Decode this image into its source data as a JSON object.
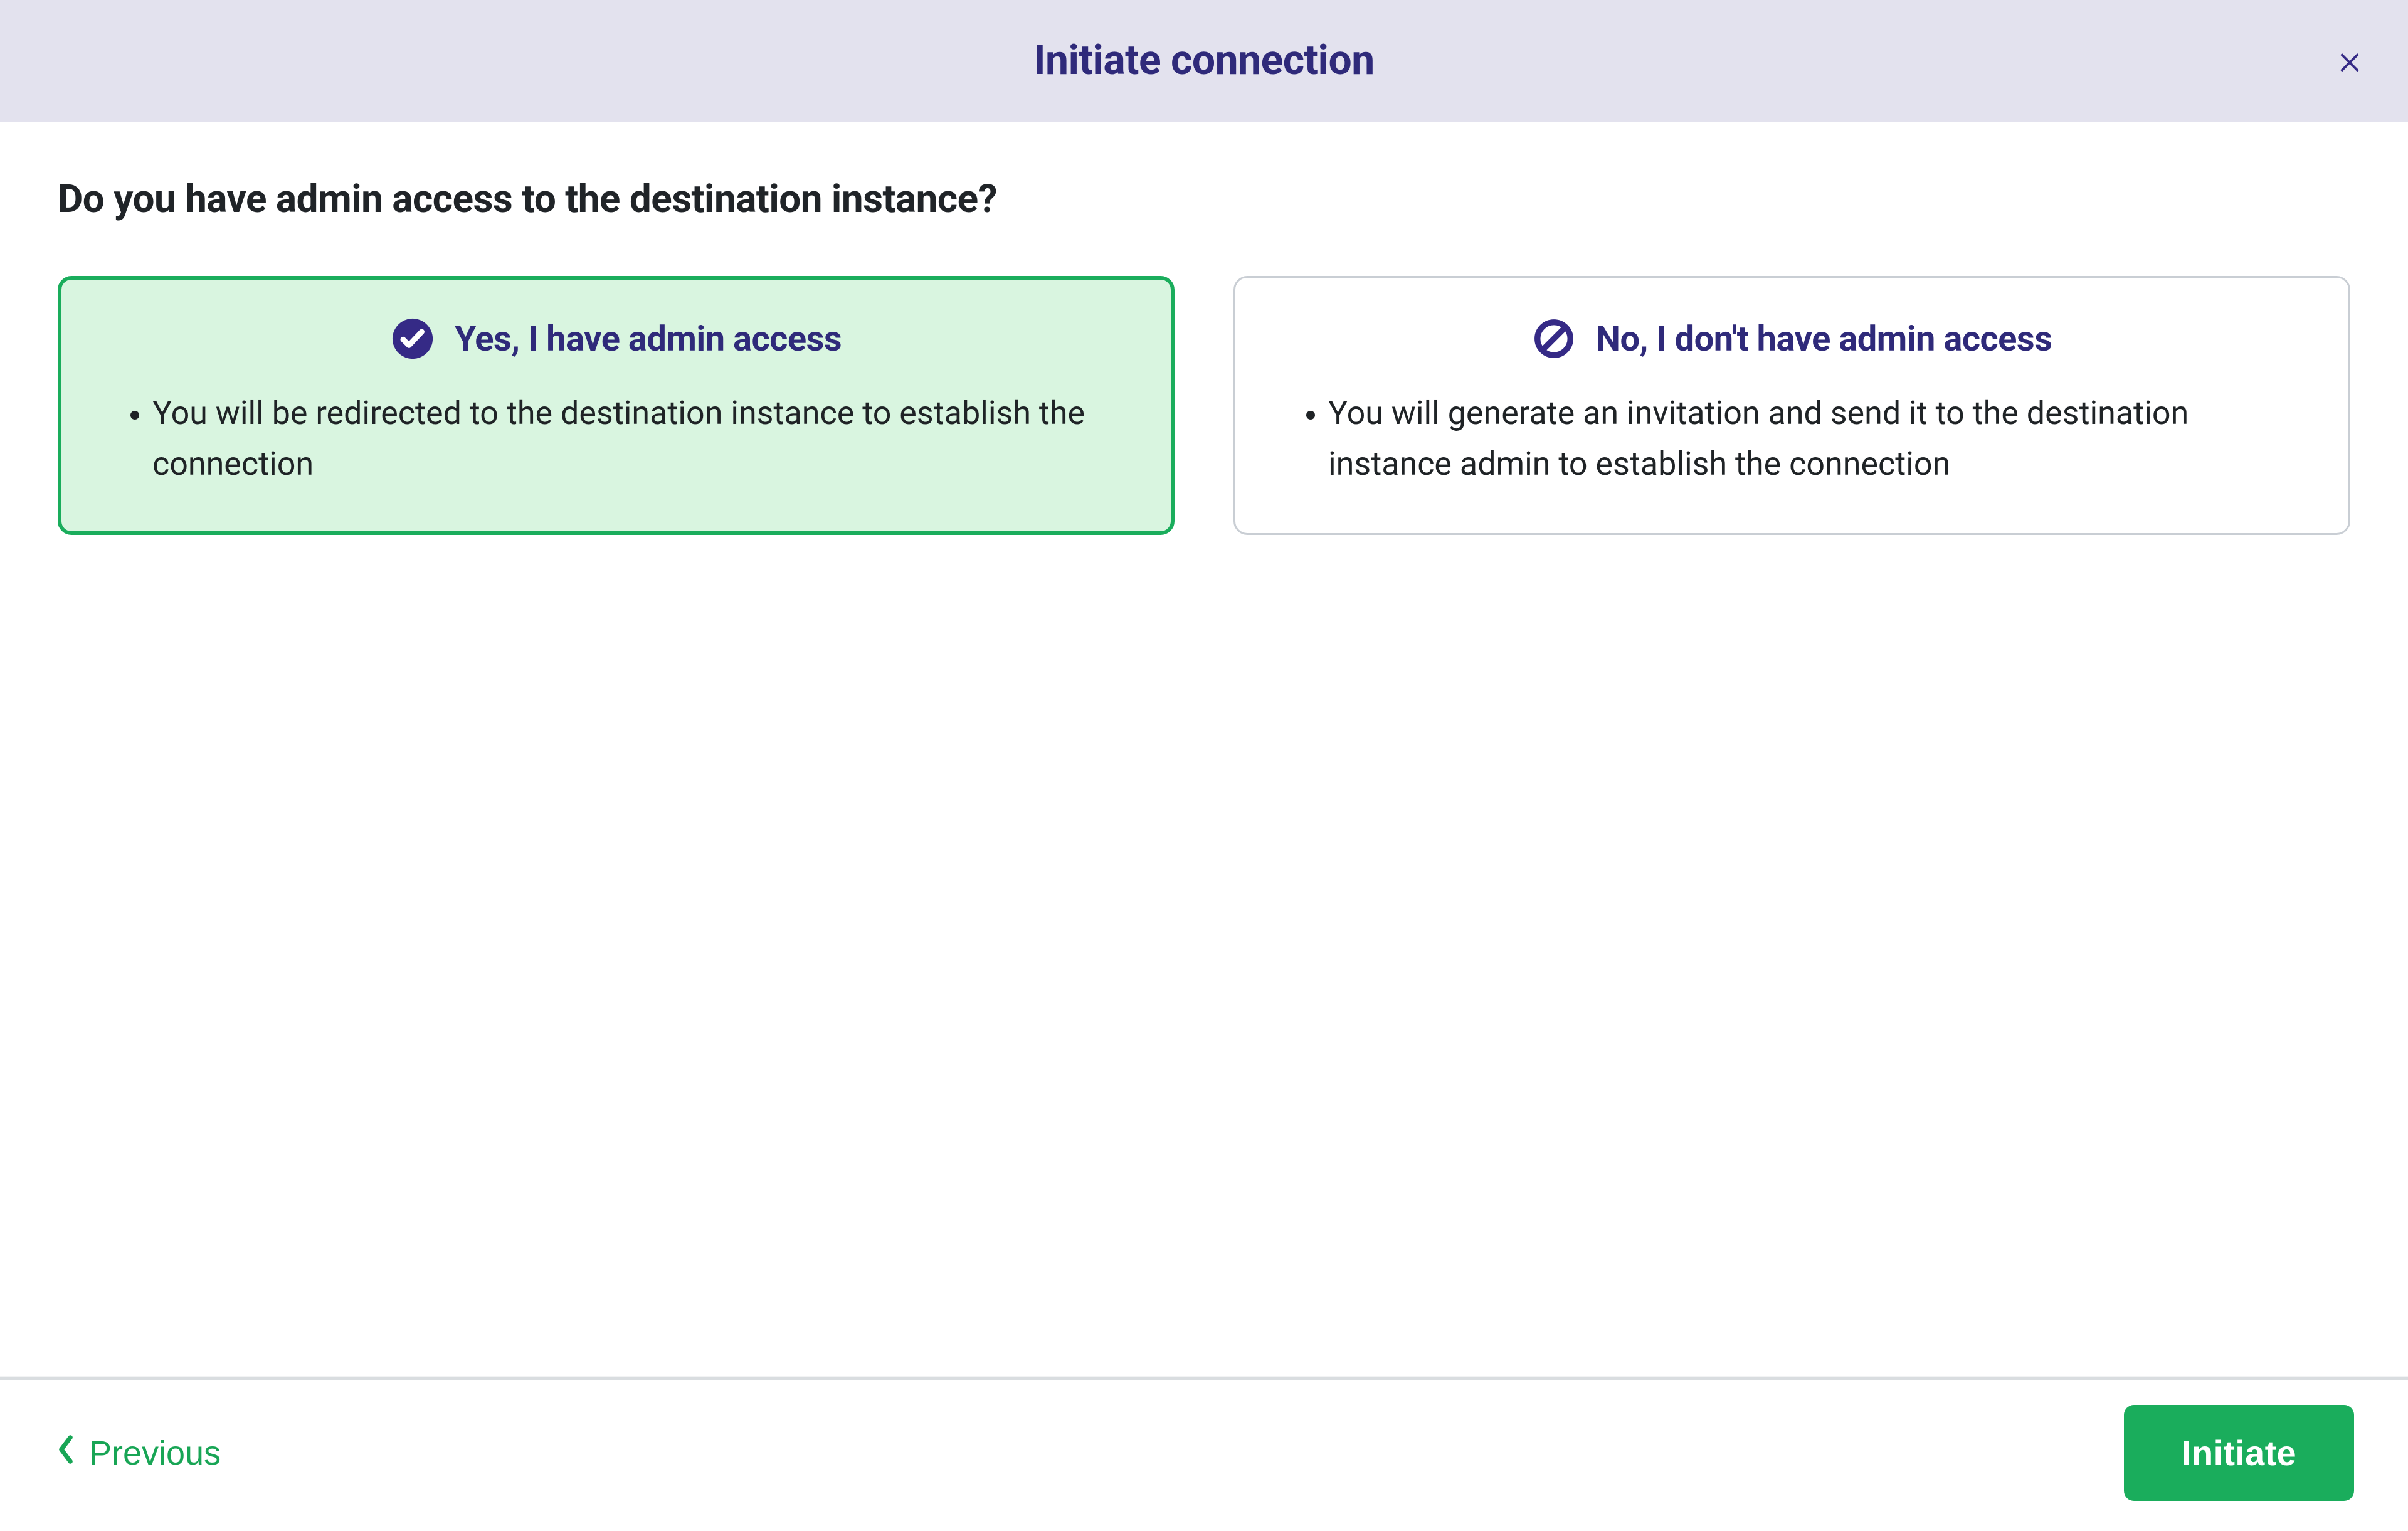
{
  "header": {
    "title": "Initiate connection"
  },
  "body": {
    "question": "Do you have admin access to the destination instance?",
    "options": {
      "yes": {
        "title": "Yes, I have admin access",
        "bullet": "You will be redirected to the destination instance to establish the connection",
        "selected": true
      },
      "no": {
        "title": "No, I don't have admin access",
        "bullet": "You will generate an invitation and send it to the destination instance admin to establish the connection",
        "selected": false
      }
    }
  },
  "footer": {
    "previous_label": "Previous",
    "primary_label": "Initiate"
  },
  "colors": {
    "accent": "#352a86",
    "primary": "#1aad5c"
  }
}
